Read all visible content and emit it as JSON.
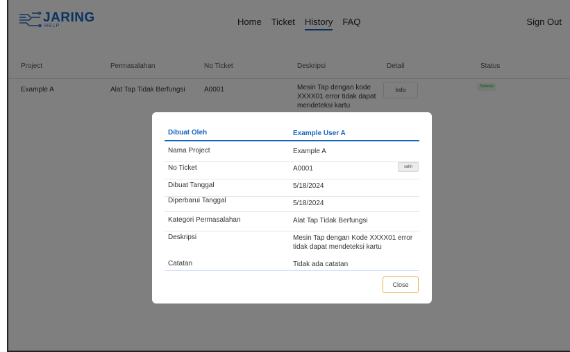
{
  "header": {
    "logo_title": "JARING",
    "logo_sub": "HELP",
    "nav": [
      "Home",
      "Ticket",
      "History",
      "FAQ"
    ],
    "active_nav": "History",
    "signout": "Sign Out"
  },
  "table": {
    "columns": [
      "Project",
      "Permasalahan",
      "No Ticket",
      "Deskripsi",
      "Detail",
      "Status"
    ],
    "rows": [
      {
        "project": "Example A",
        "permasalahan": "Alat Tap Tidak Berfungsi",
        "no_ticket": "A0001",
        "deskripsi": "Mesin Tap dengan kode XXXX01 error tidak dapat mendeteksi kartu",
        "detail_label": "Info",
        "status": "Selesai"
      }
    ]
  },
  "modal": {
    "header_label": "Dibuat Oleh",
    "header_value": "Example User A",
    "rows": [
      {
        "label": "Nama Project",
        "value": "Example A"
      },
      {
        "label": "No Ticket",
        "value": "A0001"
      },
      {
        "label": "Dibuat Tanggal",
        "value": "5/18/2024"
      },
      {
        "label": "Diperbarui Tanggal",
        "value": "5/18/2024"
      },
      {
        "label": "Kategori Permasalahan",
        "value": "Alat Tap Tidak Berfungsi"
      },
      {
        "label": "Deskripsi",
        "value": "Mesin Tap dengan Kode XXXX01 error tidak dapat mendeteksi kartu"
      },
      {
        "label": "Catatan",
        "value": "Tidak ada catatan"
      }
    ],
    "copy_label": "salin",
    "close_label": "Close"
  },
  "colors": {
    "brand": "#1565c0",
    "status_done": "#2a9d3e",
    "close_border": "#e8b04b"
  }
}
